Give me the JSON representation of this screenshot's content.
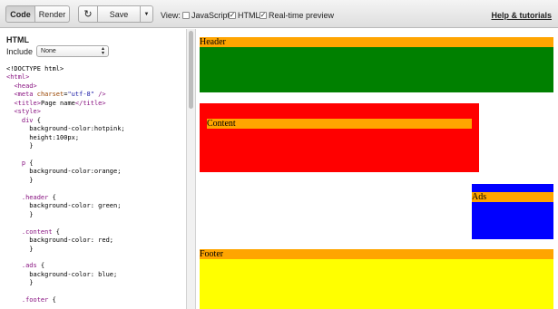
{
  "toolbar": {
    "code_label": "Code",
    "render_label": "Render",
    "refresh_symbol": "↻",
    "save_label": "Save",
    "dropdown_symbol": "▼",
    "view_label": "View:",
    "options": [
      {
        "label": "JavaScript",
        "checked": false
      },
      {
        "label": "HTML",
        "checked": true
      },
      {
        "label": "Real-time preview",
        "checked": true
      }
    ],
    "help_label": "Help & tutorials"
  },
  "editor": {
    "title": "HTML",
    "include_label": "Include",
    "include_value": "None"
  },
  "preview": {
    "header_text": "Header",
    "content_text": "Content",
    "ads_text": "Ads",
    "footer_text": "Footer"
  },
  "colors": {
    "header": "#008000",
    "content": "#ff0000",
    "ads": "#0000ff",
    "footer": "#ffff00",
    "paragraph": "#ffa500"
  }
}
